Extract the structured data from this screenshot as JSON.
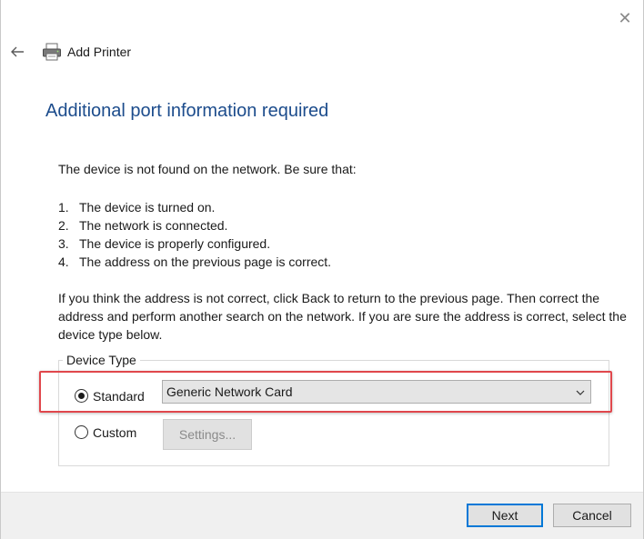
{
  "window": {
    "title": "Add Printer",
    "close_glyph": "✕",
    "back_icon": "back-arrow-icon",
    "app_icon": "printer-icon"
  },
  "page": {
    "heading": "Additional port information required",
    "intro": "The device is not found on the network.  Be sure that:",
    "checklist": [
      {
        "num": "1.",
        "text": "The device is turned on."
      },
      {
        "num": "2.",
        "text": "The network is connected."
      },
      {
        "num": "3.",
        "text": "The device is properly configured."
      },
      {
        "num": "4.",
        "text": "The address on the previous page is correct."
      }
    ],
    "paragraph": "If you think the address is not correct, click Back to return to the previous page.  Then correct the address and perform another search on the network.  If you are sure the address is correct, select the device type below."
  },
  "device_type": {
    "legend": "Device Type",
    "standard_label": "Standard",
    "standard_selected": true,
    "standard_value": "Generic Network Card",
    "custom_label": "Custom",
    "custom_selected": false,
    "settings_label": "Settings...",
    "settings_enabled": false
  },
  "footer": {
    "next_label": "Next",
    "cancel_label": "Cancel"
  },
  "colors": {
    "heading": "#1c4c8c",
    "highlight": "#e0474c",
    "default_button_border": "#0078d7",
    "footer_bg": "#f0f0f0"
  }
}
